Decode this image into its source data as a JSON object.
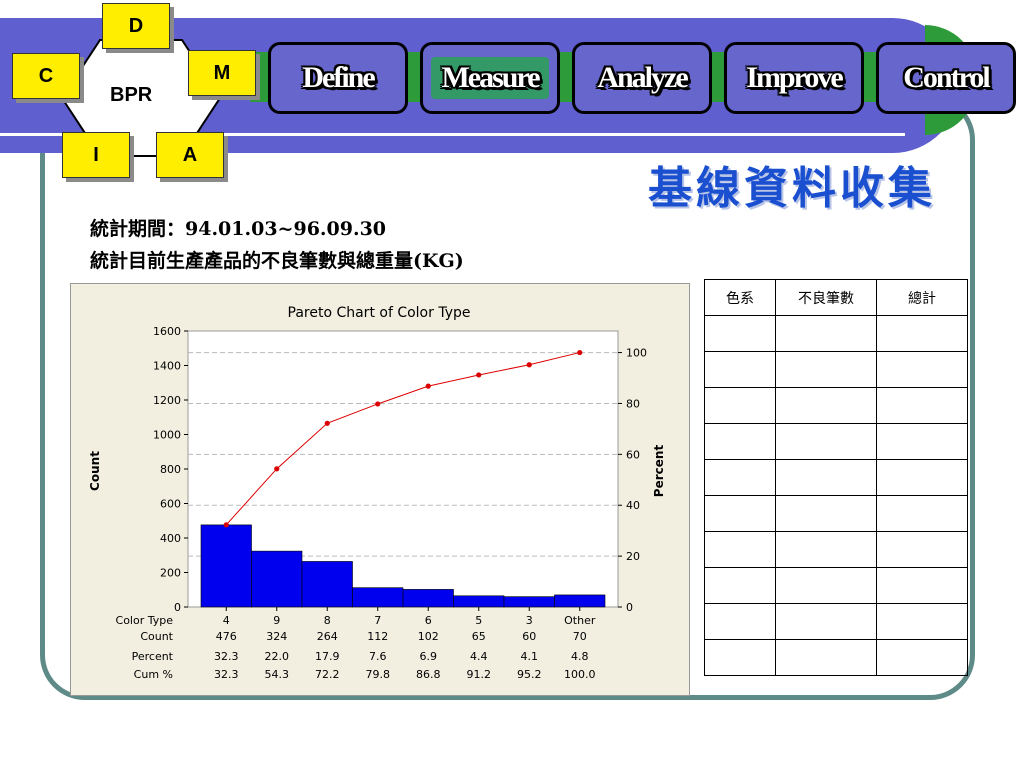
{
  "bpr": {
    "center": "BPR",
    "steps": [
      "D",
      "M",
      "A",
      "I",
      "C"
    ]
  },
  "nav": [
    "Define",
    "Measure",
    "Analyze",
    "Improve",
    "Control"
  ],
  "nav_active": "Measure",
  "title": "基線資料收集",
  "info_line1": "統計期間：94.01.03~96.09.30",
  "info_line2": "統計目前生產產品的不良筆數與總重量(KG)",
  "table": {
    "headers": [
      "色系",
      "不良筆數",
      "總計"
    ],
    "row_count": 10
  },
  "colors": {
    "bar": "#0000ee",
    "line": "#dd0000",
    "title": "#1a4fd0"
  },
  "chart_data": {
    "type": "bar",
    "title": "Pareto Chart of Color Type",
    "ylabel": "Count",
    "y2label": "Percent",
    "ylim": [
      0,
      1600
    ],
    "y2lim": [
      0,
      100
    ],
    "yticks": [
      0,
      200,
      400,
      600,
      800,
      1000,
      1200,
      1400,
      1600
    ],
    "y2ticks": [
      0,
      20,
      40,
      60,
      80,
      100
    ],
    "row_labels": [
      "Color Type",
      "Count",
      "Percent",
      "Cum %"
    ],
    "categories": [
      "4",
      "9",
      "8",
      "7",
      "6",
      "5",
      "3",
      "Other"
    ],
    "counts": [
      "476",
      "324",
      "264",
      "112",
      "102",
      "65",
      "60",
      "70"
    ],
    "percents": [
      "32.3",
      "22.0",
      "17.9",
      "7.6",
      "6.9",
      "4.4",
      "4.1",
      "4.8"
    ],
    "cum_percents": [
      "32.3",
      "54.3",
      "72.2",
      "79.8",
      "86.8",
      "91.2",
      "95.2",
      "100.0"
    ],
    "values": [
      476,
      324,
      264,
      112,
      102,
      65,
      60,
      70
    ],
    "cumulative": [
      32.3,
      54.3,
      72.2,
      79.8,
      86.8,
      91.2,
      95.2,
      100.0
    ]
  }
}
